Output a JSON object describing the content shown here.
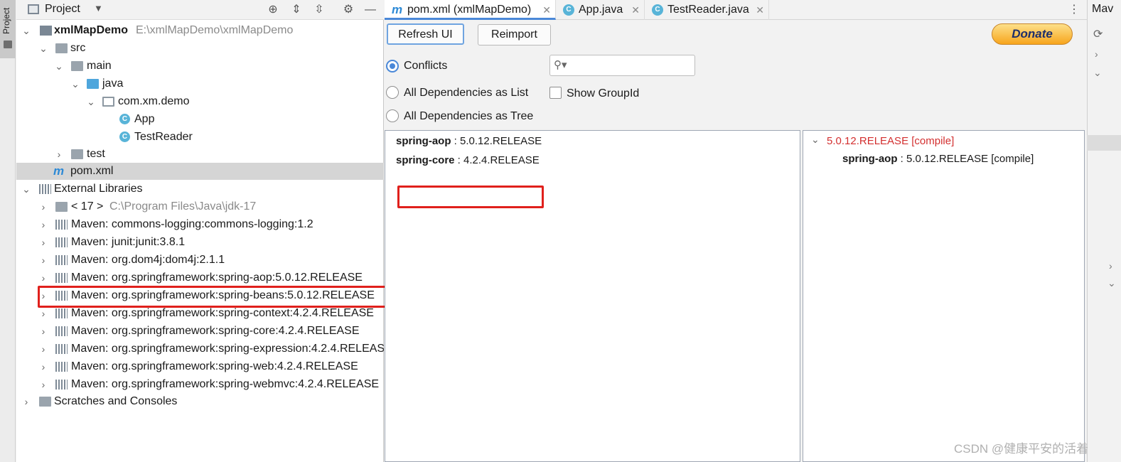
{
  "toolstrip": {
    "label": "Project"
  },
  "project_panel": {
    "title": "Project",
    "tree": [
      {
        "id": "root",
        "label": "xmlMapDemo",
        "path": "E:\\xmlMapDemo\\xmlMapDemo"
      },
      {
        "id": "src",
        "label": "src"
      },
      {
        "id": "main",
        "label": "main"
      },
      {
        "id": "java",
        "label": "java"
      },
      {
        "id": "pkg",
        "label": "com.xm.demo"
      },
      {
        "id": "app",
        "label": "App"
      },
      {
        "id": "testreader",
        "label": "TestReader"
      },
      {
        "id": "test",
        "label": "test"
      },
      {
        "id": "pom",
        "label": "pom.xml"
      },
      {
        "id": "extlibs",
        "label": "External Libraries"
      },
      {
        "id": "jdk",
        "label": "< 17 >",
        "path": "C:\\Program Files\\Java\\jdk-17"
      },
      {
        "id": "lib1",
        "label": "Maven: commons-logging:commons-logging:1.2"
      },
      {
        "id": "lib2",
        "label": "Maven: junit:junit:3.8.1"
      },
      {
        "id": "lib3",
        "label": "Maven: org.dom4j:dom4j:2.1.1"
      },
      {
        "id": "lib4",
        "label": "Maven: org.springframework:spring-aop:5.0.12.RELEASE"
      },
      {
        "id": "lib5",
        "label": "Maven: org.springframework:spring-beans:5.0.12.RELEASE"
      },
      {
        "id": "lib6",
        "label": "Maven: org.springframework:spring-context:4.2.4.RELEASE"
      },
      {
        "id": "lib7",
        "label": "Maven: org.springframework:spring-core:4.2.4.RELEASE"
      },
      {
        "id": "lib8",
        "label": "Maven: org.springframework:spring-expression:4.2.4.RELEAS"
      },
      {
        "id": "lib9",
        "label": "Maven: org.springframework:spring-web:4.2.4.RELEASE"
      },
      {
        "id": "lib10",
        "label": "Maven: org.springframework:spring-webmvc:4.2.4.RELEASE"
      },
      {
        "id": "scratches",
        "label": "Scratches and Consoles"
      }
    ]
  },
  "tabs": [
    {
      "label": "pom.xml (xmlMapDemo)",
      "active": true
    },
    {
      "label": "App.java"
    },
    {
      "label": "TestReader.java"
    }
  ],
  "analyzer": {
    "refresh_label": "Refresh UI",
    "reimport_label": "Reimport",
    "donate_label": "Donate",
    "options": {
      "conflicts": "Conflicts",
      "as_list": "All Dependencies as List",
      "as_tree": "All Dependencies as Tree",
      "show_groupid": "Show GroupId"
    },
    "search_placeholder": "",
    "conflicts": [
      {
        "name": "spring-aop",
        "version": "5.0.12.RELEASE"
      },
      {
        "name": "spring-core",
        "version": "4.2.4.RELEASE"
      }
    ],
    "detail": {
      "version": "5.0.12.RELEASE [compile]",
      "child_name": "spring-aop",
      "child_version": "5.0.12.RELEASE [compile]"
    }
  },
  "maven_panel": {
    "title": "Mav"
  },
  "watermark": "CSDN @健康平安的活着",
  "colors": {
    "accent": "#4a88d8",
    "highlight_box": "#e0201c",
    "conflict_version": "#d32f2f"
  }
}
